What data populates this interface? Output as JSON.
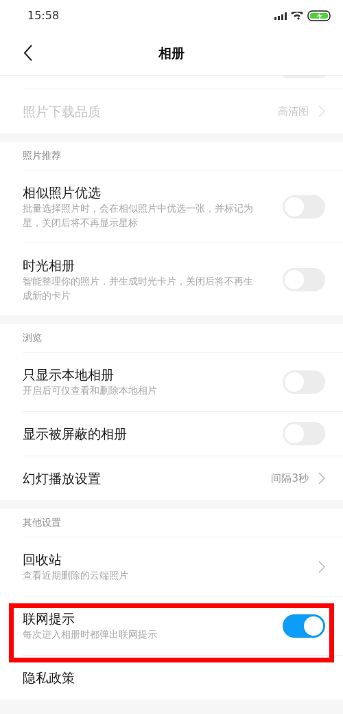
{
  "status_bar": {
    "time": "15:58"
  },
  "header": {
    "title": "相册"
  },
  "cut_row": {
    "on": false
  },
  "sections": [
    {
      "rows": [
        {
          "kind": "link",
          "title": "照片下载品质",
          "value": "高清图",
          "disabled": true,
          "highlighted": false
        }
      ]
    },
    {
      "heading": "照片推荐",
      "rows": [
        {
          "kind": "switch",
          "title": "相似照片优选",
          "subtitle": "批量选择照片时，会在相似照片中优选一张，并标记为星，关闭后将不再显示星标",
          "on": false,
          "highlighted": false
        },
        {
          "kind": "switch",
          "title": "时光相册",
          "subtitle": "智能整理你的照片，并生成时光卡片，关闭后将不再生成新的卡片",
          "on": false,
          "highlighted": false
        }
      ]
    },
    {
      "heading": "浏览",
      "rows": [
        {
          "kind": "switch",
          "title": "只显示本地相册",
          "subtitle": "开启后可仅查看和删除本地相片",
          "on": false,
          "highlighted": false
        },
        {
          "kind": "switch",
          "title": "显示被屏蔽的相册",
          "on": false,
          "highlighted": false
        },
        {
          "kind": "link",
          "title": "幻灯播放设置",
          "value": "间隔3秒",
          "disabled": false,
          "highlighted": false
        }
      ]
    },
    {
      "heading": "其他设置",
      "rows": [
        {
          "kind": "link",
          "title": "回收站",
          "subtitle": "查看近期删除的云端照片",
          "disabled": false,
          "highlighted": false
        },
        {
          "kind": "switch",
          "title": "联网提示",
          "subtitle": "每次进入相册时都弹出联网提示",
          "on": true,
          "highlighted": true
        },
        {
          "kind": "plain",
          "title": "隐私政策",
          "highlighted": false
        }
      ]
    }
  ]
}
